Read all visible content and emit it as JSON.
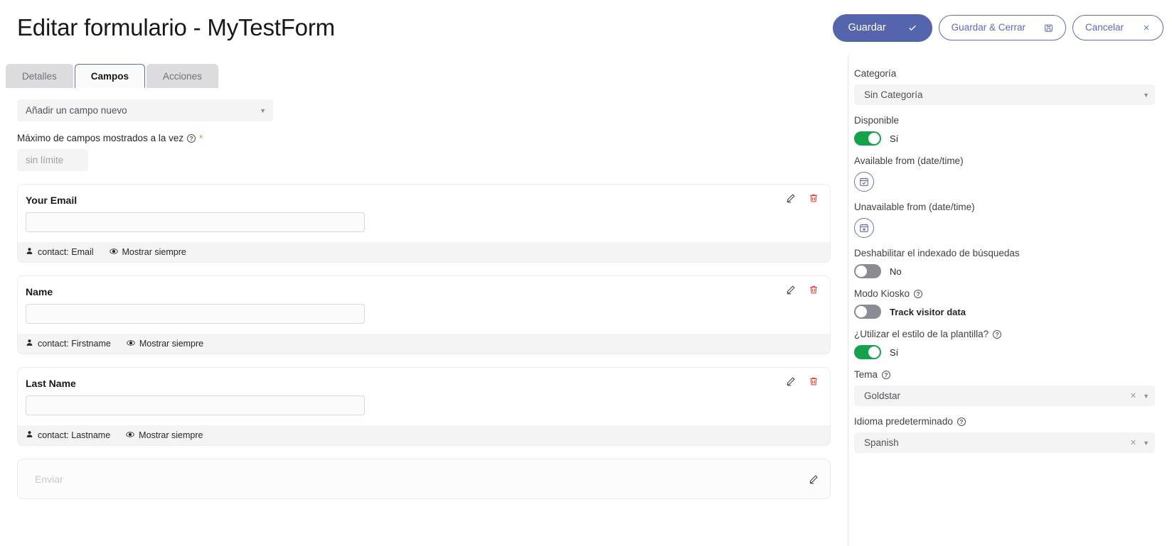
{
  "header": {
    "title": "Editar formulario - MyTestForm",
    "actions": [
      {
        "label": "Guardar",
        "icon": "check-icon",
        "style": "primary"
      },
      {
        "label": "Guardar & Cerrar",
        "icon": "save-disk-icon",
        "style": "outline"
      },
      {
        "label": "Cancelar",
        "icon": "close-x-icon",
        "style": "outline"
      }
    ]
  },
  "tabs": [
    {
      "label": "Detalles",
      "active": false
    },
    {
      "label": "Campos",
      "active": true
    },
    {
      "label": "Acciones",
      "active": false
    }
  ],
  "editor": {
    "add_field_placeholder": "Añadir un campo nuevo",
    "max_fields_label": "Máximo de campos mostrados a la vez",
    "max_fields_value": "",
    "max_fields_placeholder": "sin límite",
    "fields": [
      {
        "title": "Your Email",
        "value": "",
        "mapping": "contact: Email",
        "visibility": "Mostrar siempre"
      },
      {
        "title": "Name",
        "value": "",
        "mapping": "contact: Firstname",
        "visibility": "Mostrar siempre"
      },
      {
        "title": "Last Name",
        "value": "",
        "mapping": "contact: Lastname",
        "visibility": "Mostrar siempre"
      }
    ],
    "submit_label": "Enviar"
  },
  "settings": {
    "category": {
      "label": "Categoría",
      "value": "Sin Categoría"
    },
    "available": {
      "label": "Disponible",
      "state": "Sí",
      "on": true
    },
    "available_from": {
      "label": "Available from (date/time)",
      "icon": "calendar-check-icon"
    },
    "unavailable_from": {
      "label": "Unavailable from (date/time)",
      "icon": "calendar-x-icon"
    },
    "disable_index": {
      "label": "Deshabilitar el indexado de búsquedas",
      "state": "No",
      "on": false
    },
    "kiosk_mode": {
      "label": "Modo Kiosko",
      "state": "Track visitor data",
      "on": false
    },
    "template_style": {
      "label": "¿Utilizar el estilo de la plantilla?",
      "state": "Sí",
      "on": true
    },
    "theme": {
      "label": "Tema",
      "value": "Goldstar"
    },
    "language": {
      "label": "Idioma predeterminado",
      "value": "Spanish"
    }
  },
  "colors": {
    "primary": "#5565ad",
    "toggle_on": "#14a34a",
    "toggle_off": "#8b8b93",
    "danger": "#e8392f",
    "required": "#f0734a"
  }
}
